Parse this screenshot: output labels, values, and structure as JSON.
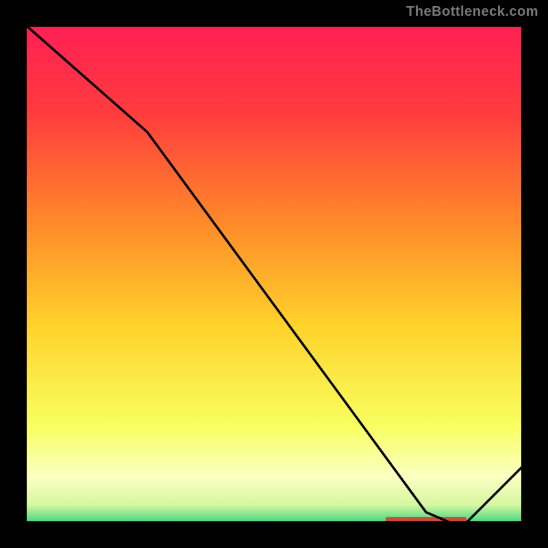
{
  "watermark": "TheBottleneck.com",
  "chart_data": {
    "type": "line",
    "title": "",
    "xlabel": "",
    "ylabel": "",
    "xlim": [
      0,
      100
    ],
    "ylim": [
      0,
      100
    ],
    "grid": false,
    "series": [
      {
        "name": "curve",
        "x": [
          0,
          25,
          80,
          87,
          100
        ],
        "y": [
          100,
          78,
          3,
          0,
          13
        ]
      }
    ],
    "flat_zone": {
      "x0": 72,
      "x1": 88,
      "y": 1.5,
      "color": "#c94d3d"
    },
    "background_gradient": [
      {
        "offset": 0.0,
        "color": "#ff1e55"
      },
      {
        "offset": 0.18,
        "color": "#ff3b3e"
      },
      {
        "offset": 0.4,
        "color": "#ff8a2a"
      },
      {
        "offset": 0.6,
        "color": "#ffd22a"
      },
      {
        "offset": 0.8,
        "color": "#f8ff60"
      },
      {
        "offset": 0.9,
        "color": "#fbffc2"
      },
      {
        "offset": 0.955,
        "color": "#d7f7a2"
      },
      {
        "offset": 0.98,
        "color": "#6fdf8a"
      },
      {
        "offset": 1.0,
        "color": "#1fd370"
      }
    ]
  }
}
